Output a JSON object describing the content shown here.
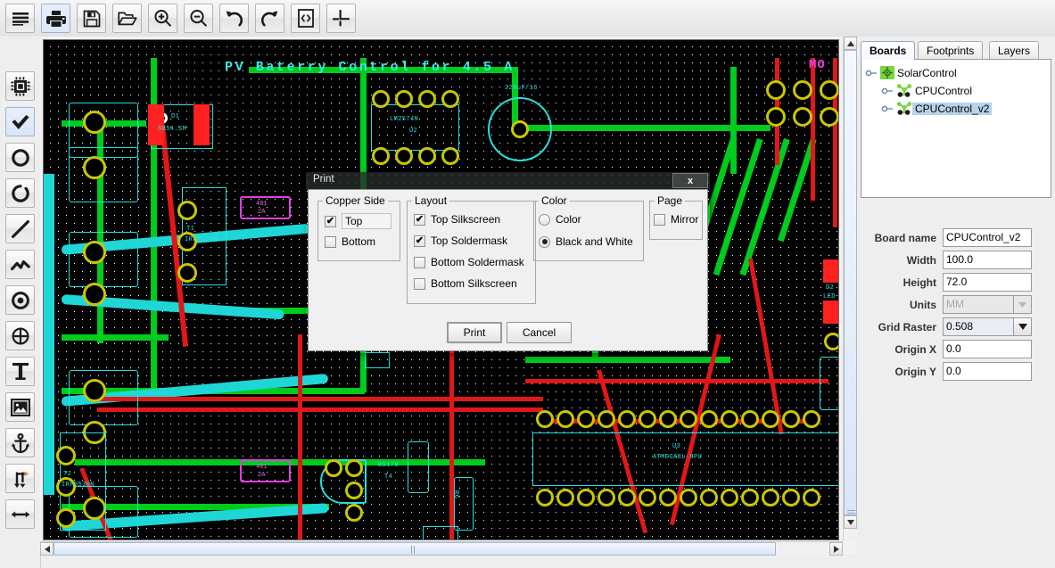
{
  "app": {
    "title": "PCB Editor"
  },
  "toolbar": {
    "items": [
      {
        "name": "menu-icon",
        "label": "Menu"
      },
      {
        "name": "print-icon",
        "label": "Print",
        "selected": true
      },
      {
        "name": "save-icon",
        "label": "Save"
      },
      {
        "name": "open-icon",
        "label": "Open"
      },
      {
        "name": "zoom-in-icon",
        "label": "Zoom In"
      },
      {
        "name": "zoom-out-icon",
        "label": "Zoom Out"
      },
      {
        "name": "undo-icon",
        "label": "Undo"
      },
      {
        "name": "redo-icon",
        "label": "Redo"
      },
      {
        "name": "code-icon",
        "label": "Code"
      },
      {
        "name": "corner-icon",
        "label": "Corner"
      }
    ]
  },
  "lefttoolbar": {
    "items": [
      {
        "name": "chip-icon",
        "label": "Package"
      },
      {
        "name": "check-icon",
        "label": "Select",
        "selected": true
      },
      {
        "name": "circle-icon",
        "label": "Circle"
      },
      {
        "name": "arc-icon",
        "label": "Arc"
      },
      {
        "name": "line-icon",
        "label": "Line"
      },
      {
        "name": "polyline-icon",
        "label": "Polyline"
      },
      {
        "name": "via-icon",
        "label": "Via"
      },
      {
        "name": "hole-icon",
        "label": "Hole"
      },
      {
        "name": "text-icon",
        "label": "Text"
      },
      {
        "name": "image-icon",
        "label": "Image"
      },
      {
        "name": "anchor-icon",
        "label": "Anchor"
      },
      {
        "name": "move-icon",
        "label": "Move"
      },
      {
        "name": "dimension-icon",
        "label": "Dimension"
      }
    ]
  },
  "canvas": {
    "board_title": "PV Baterry Control for 4.5 A",
    "corner_mark": "MO",
    "designators": [
      {
        "ref": "D1",
        "value": "SB54.SM"
      },
      {
        "ref": "U2",
        "value": "LM2574N"
      },
      {
        "ref": "T1",
        "value": "IRF9530N"
      },
      {
        "ref": "T2",
        "value": "IRF9530N"
      },
      {
        "ref": "T4",
        "value": "BS170"
      },
      {
        "ref": "U3",
        "value": "ATMEGA8L-8PU"
      },
      {
        "ref": "D2",
        "value": "LED"
      },
      {
        "ref": "R2",
        "value": ""
      },
      {
        "ref": "C1",
        "value": "220uF/16"
      },
      {
        "ref": "R6",
        "value": "2k"
      }
    ],
    "fuse_labels": [
      "401",
      "2A"
    ],
    "colors": {
      "background": "#000000",
      "silkscreen": "#2fe3e3",
      "top_copper": "#00d21e",
      "bottom_copper": "#e01818",
      "pad": "#c8c800",
      "keepout": "#2fe3e3",
      "text_magenta": "#e040e0"
    }
  },
  "scrollbars": {
    "vertical_up": "▲",
    "vertical_down": "▼",
    "horizontal_left": "◀",
    "horizontal_right": "▶"
  },
  "right_panel": {
    "tabs": [
      {
        "label": "Boards",
        "active": true
      },
      {
        "label": "Footprints",
        "active": false
      },
      {
        "label": "Layers",
        "active": false
      }
    ],
    "tree": [
      {
        "label": "SolarControl",
        "depth": 0,
        "selected": false,
        "icon": "board-root-icon"
      },
      {
        "label": "CPUControl",
        "depth": 1,
        "selected": false,
        "icon": "board-node-icon"
      },
      {
        "label": "CPUControl_v2",
        "depth": 1,
        "selected": true,
        "icon": "board-node-icon"
      }
    ],
    "properties": [
      {
        "label": "Board name",
        "value": "CPUControl_v2",
        "type": "text",
        "disabled": false
      },
      {
        "label": "Width",
        "value": "100.0",
        "type": "text",
        "disabled": false
      },
      {
        "label": "Height",
        "value": "72.0",
        "type": "text",
        "disabled": false
      },
      {
        "label": "Units",
        "value": "MM",
        "type": "combo",
        "disabled": true
      },
      {
        "label": "Grid Raster",
        "value": "0.508",
        "type": "combo",
        "disabled": false
      },
      {
        "label": "Origin X",
        "value": "0.0",
        "type": "text",
        "disabled": false
      },
      {
        "label": "Origin Y",
        "value": "0.0",
        "type": "text",
        "disabled": false
      }
    ]
  },
  "print_dialog": {
    "title": "Print",
    "close_label": "x",
    "groups": {
      "copper_side": {
        "title": "Copper Side",
        "options": [
          {
            "label": "Top",
            "checked": true
          },
          {
            "label": "Bottom",
            "checked": false
          }
        ]
      },
      "layout": {
        "title": "Layout",
        "options": [
          {
            "label": "Top Silkscreen",
            "checked": true
          },
          {
            "label": "Top Soldermask",
            "checked": true
          },
          {
            "label": "Bottom Soldermask",
            "checked": false
          },
          {
            "label": "Bottom Silkscreen",
            "checked": false
          }
        ]
      },
      "color": {
        "title": "Color",
        "options": [
          {
            "label": "Color",
            "checked": false
          },
          {
            "label": "Black and White",
            "checked": true
          }
        ]
      },
      "page": {
        "title": "Page",
        "options": [
          {
            "label": "Mirror",
            "checked": false
          }
        ]
      }
    },
    "buttons": [
      {
        "label": "Print",
        "default": true
      },
      {
        "label": "Cancel",
        "default": false
      }
    ]
  }
}
